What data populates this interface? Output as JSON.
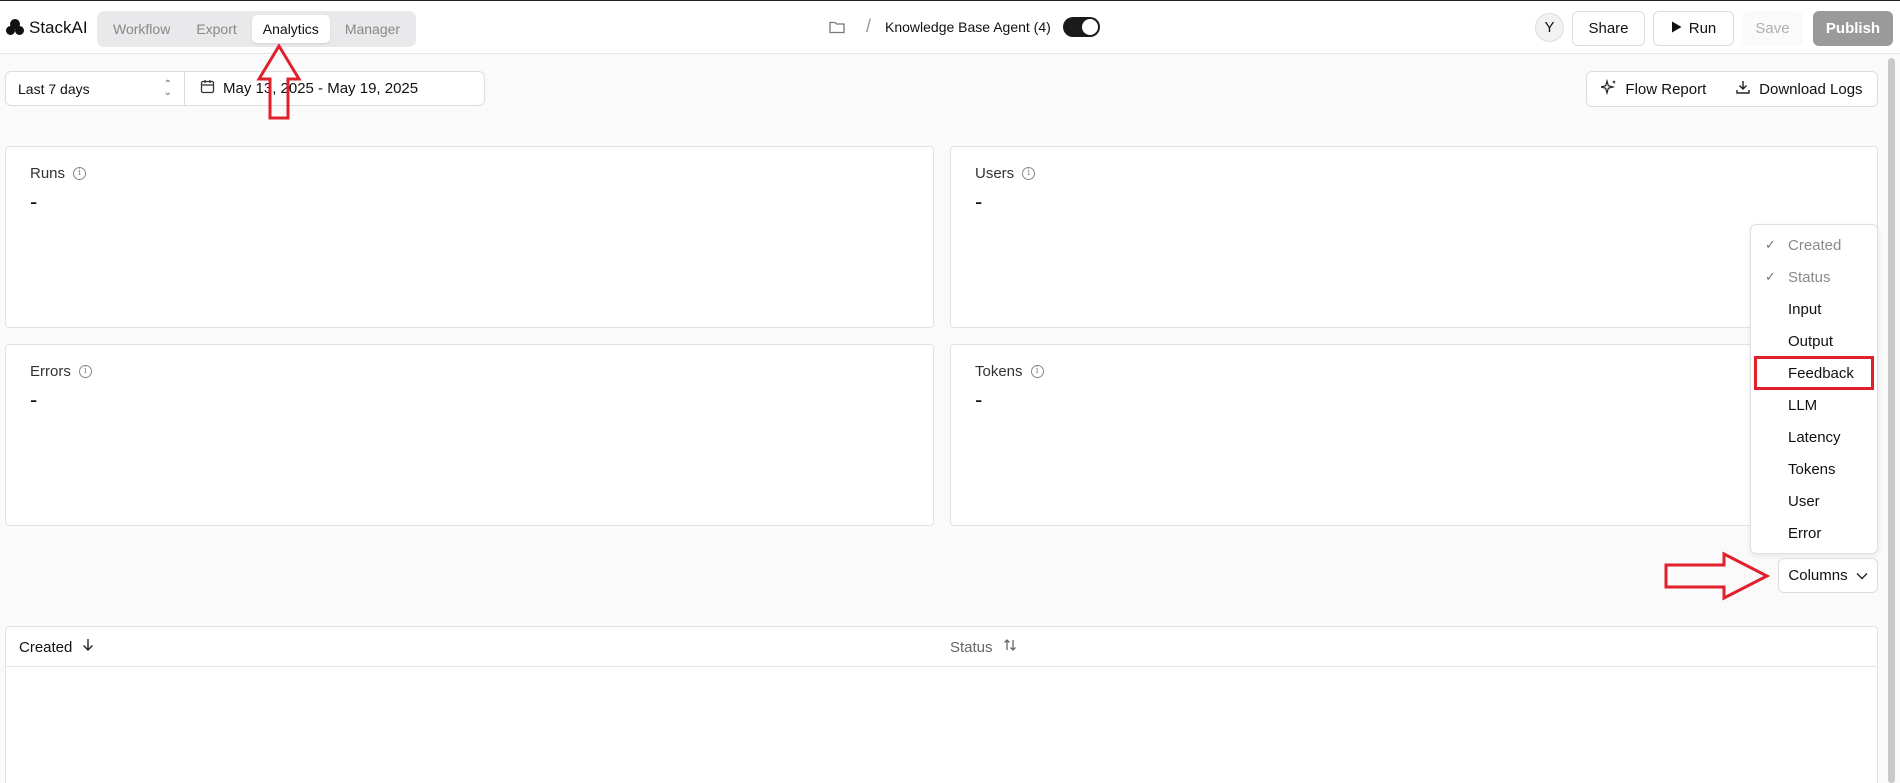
{
  "header": {
    "brand": "StackAI",
    "tabs": [
      {
        "label": "Workflow",
        "active": false
      },
      {
        "label": "Export",
        "active": false
      },
      {
        "label": "Analytics",
        "active": true
      },
      {
        "label": "Manager",
        "active": false
      }
    ],
    "breadcrumb_separator": "/",
    "agent_name": "Knowledge Base Agent (4)",
    "avatar_initial": "Y",
    "share_label": "Share",
    "run_label": "Run",
    "save_label": "Save",
    "publish_label": "Publish"
  },
  "filters": {
    "range": "Last 7 days",
    "date_range": "May 13, 2025 - May 19, 2025",
    "flow_report_label": "Flow Report",
    "download_logs_label": "Download Logs"
  },
  "metrics": [
    {
      "label": "Runs",
      "value": "-"
    },
    {
      "label": "Users",
      "value": "-"
    },
    {
      "label": "Errors",
      "value": "-"
    },
    {
      "label": "Tokens",
      "value": "-"
    }
  ],
  "columns_menu": {
    "button_label": "Columns",
    "items": [
      {
        "label": "Created",
        "checked": true
      },
      {
        "label": "Status",
        "checked": true
      },
      {
        "label": "Input",
        "checked": false
      },
      {
        "label": "Output",
        "checked": false
      },
      {
        "label": "Feedback",
        "checked": false
      },
      {
        "label": "LLM",
        "checked": false
      },
      {
        "label": "Latency",
        "checked": false
      },
      {
        "label": "Tokens",
        "checked": false
      },
      {
        "label": "User",
        "checked": false
      },
      {
        "label": "Error",
        "checked": false
      }
    ],
    "highlighted_item": "Feedback"
  },
  "table": {
    "headers": [
      {
        "label": "Created",
        "sort": "descending"
      },
      {
        "label": "Status",
        "sort": "unsorted"
      }
    ]
  },
  "colors": {
    "annotation_red": "#e0202b",
    "publish_bg": "#9a9a9a"
  }
}
